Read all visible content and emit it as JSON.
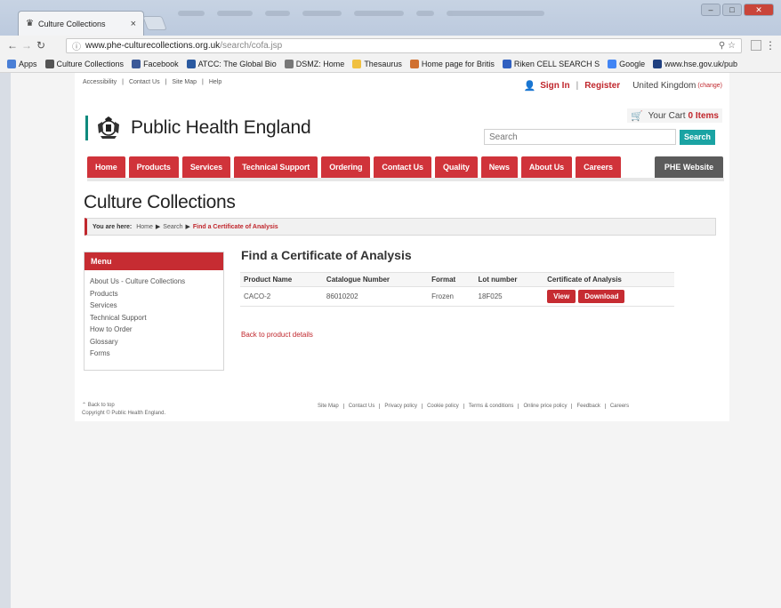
{
  "browser": {
    "tab_title": "Culture Collections",
    "tab_close": "×",
    "url_host": "www.phe-culturecollections.org.uk",
    "url_path": "/search/cofa.jsp",
    "bookmarks": [
      {
        "label": "Apps",
        "icon": "apps-icon",
        "color": "#4a7fd6"
      },
      {
        "label": "Culture Collections",
        "icon": "crest-icon",
        "color": "#555555"
      },
      {
        "label": "Facebook",
        "icon": "facebook-icon",
        "color": "#3b5998"
      },
      {
        "label": "ATCC: The Global Bio",
        "icon": "atcc-icon",
        "color": "#2b5aa0"
      },
      {
        "label": "DSMZ: Home",
        "icon": "dsmz-icon",
        "color": "#777777"
      },
      {
        "label": "Thesaurus",
        "icon": "folder-icon",
        "color": "#f0c040"
      },
      {
        "label": "Home page for Britis",
        "icon": "shield-icon",
        "color": "#d07030"
      },
      {
        "label": "Riken CELL SEARCH S",
        "icon": "riken-icon",
        "color": "#3060c0"
      },
      {
        "label": "Google",
        "icon": "google-icon",
        "color": "#4285f4"
      },
      {
        "label": "www.hse.gov.uk/pub",
        "icon": "hse-icon",
        "color": "#204080"
      }
    ]
  },
  "site": {
    "utility_links": [
      "Accessibility",
      "Contact Us",
      "Site Map",
      "Help"
    ],
    "sign_in": "Sign In",
    "register": "Register",
    "country": "United Kingdom",
    "country_change": "(change)",
    "brand": "Public Health England",
    "cart_label": "Your Cart",
    "cart_count": "0 Items",
    "search_placeholder": "Search",
    "search_button": "Search",
    "nav": [
      "Home",
      "Products",
      "Services",
      "Technical Support",
      "Ordering",
      "Contact Us",
      "Quality",
      "News",
      "About Us",
      "Careers"
    ],
    "nav_phe": "PHE Website",
    "accent": "#c62c32",
    "teal": "#1aa3a3"
  },
  "main": {
    "page_title": "Culture Collections",
    "breadcrumb_label": "You are here:",
    "breadcrumb": [
      "Home",
      "Search"
    ],
    "breadcrumb_current": "Find a Certificate of Analysis",
    "menu_title": "Menu",
    "menu_items": [
      "About Us - Culture Collections",
      "Products",
      "Services",
      "Technical Support",
      "How to Order",
      "Glossary",
      "Forms"
    ],
    "cert_title": "Find a Certificate of Analysis",
    "columns": [
      "Product Name",
      "Catalogue Number",
      "Format",
      "Lot number",
      "Certificate of Analysis"
    ],
    "row": {
      "product": "CACO-2",
      "catalogue": "86010202",
      "format": "Frozen",
      "lot": "18F025",
      "view": "View",
      "download": "Download"
    },
    "back_link": "Back to product details"
  },
  "footer": {
    "back_to_top": "Back to top",
    "copyright": "Copyright © Public Health England.",
    "links": [
      "Site Map",
      "Contact Us",
      "Privacy policy",
      "Cookie policy",
      "Terms & conditions",
      "Online price policy",
      "Feedback",
      "Careers"
    ]
  }
}
